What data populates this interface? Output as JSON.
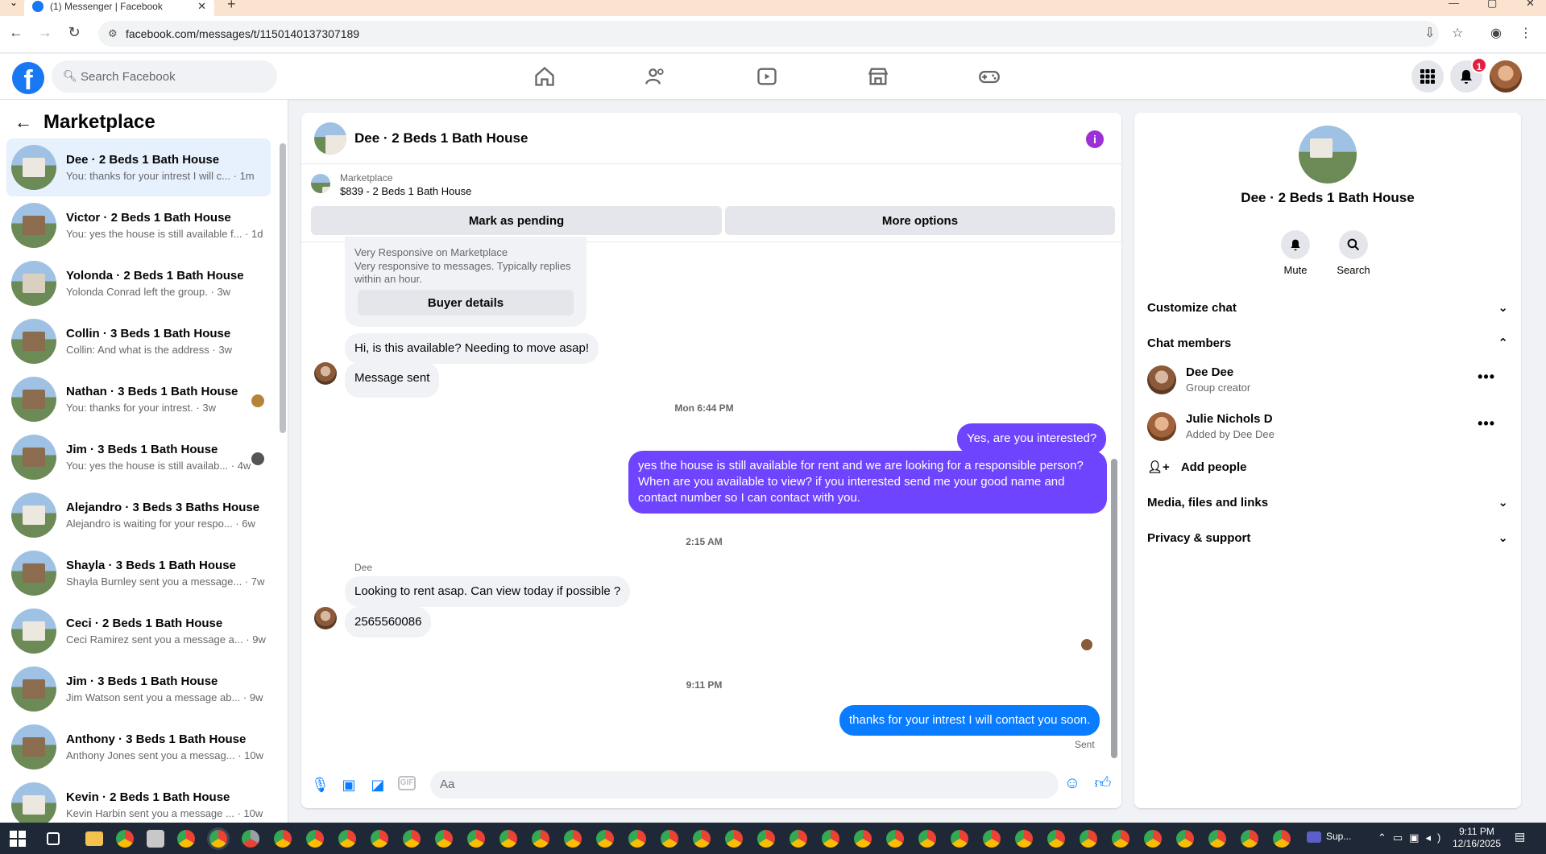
{
  "browser": {
    "tab_title": "(1) Messenger | Facebook",
    "url": "facebook.com/messages/t/1150140137307189"
  },
  "fb": {
    "search_placeholder": "Search Facebook",
    "notification_count": "1"
  },
  "left": {
    "title": "Marketplace",
    "conversations": [
      {
        "name": "Dee · 2 Beds 1 Bath House",
        "snippet": "You: thanks for your intrest I will c...",
        "time": "· 1m"
      },
      {
        "name": "Victor · 2 Beds 1 Bath House",
        "snippet": "You: yes the house is still available f...",
        "time": "· 1d"
      },
      {
        "name": "Yolonda · 2 Beds 1 Bath House",
        "snippet": "Yolonda Conrad left the group.",
        "time": "· 3w"
      },
      {
        "name": "Collin · 3 Beds 1 Bath House",
        "snippet": "Collin: And what is the address",
        "time": "· 3w"
      },
      {
        "name": "Nathan · 3 Beds 1 Bath House",
        "snippet": "You: thanks for your intrest.",
        "time": "· 3w"
      },
      {
        "name": "Jim · 3 Beds 1 Bath House",
        "snippet": "You: yes the house is still availab...",
        "time": "· 4w"
      },
      {
        "name": "Alejandro · 3 Beds 3 Baths House",
        "snippet": "Alejandro is waiting for your respo...",
        "time": "· 6w"
      },
      {
        "name": "Shayla · 3 Beds 1 Bath House",
        "snippet": "Shayla Burnley sent you a message...",
        "time": "· 7w"
      },
      {
        "name": "Ceci · 2 Beds 1 Bath House",
        "snippet": "Ceci Ramirez sent you a message a...",
        "time": "· 9w"
      },
      {
        "name": "Jim · 3 Beds 1 Bath House",
        "snippet": "Jim Watson sent you a message ab...",
        "time": "· 9w"
      },
      {
        "name": "Anthony · 3 Beds 1 Bath House",
        "snippet": "Anthony Jones sent you a messag...",
        "time": "· 10w"
      },
      {
        "name": "Kevin · 2 Beds 1 Bath House",
        "snippet": "Kevin Harbin sent you a message ...",
        "time": "· 10w"
      }
    ]
  },
  "chat": {
    "title": "Dee · 2 Beds 1 Bath House",
    "marketplace_label": "Marketplace",
    "listing": "$839 - 2 Beds 1 Bath House",
    "mark_pending": "Mark as pending",
    "more_options": "More options",
    "card_heading": "Very Responsive on Marketplace",
    "card_desc": "Very responsive to messages. Typically replies within an hour.",
    "buyer_details": "Buyer details",
    "msg1": "Hi, is this available? Needing to move asap!",
    "msg2": "Message sent",
    "ts1": "Mon 6:44 PM",
    "out1": "Yes, are you interested?",
    "out2": "yes the house is still available for rent and we are looking for a responsible person? When are you available to view? if you interested send me your good name and contact number  so I can contact with you.",
    "ts2": "2:15 AM",
    "sender": "Dee",
    "msg3": "Looking to rent asap. Can view today if possible ?",
    "msg4": "2565560086",
    "ts3": "9:11 PM",
    "out3": "thanks for your intrest I will contact you soon.",
    "sent": "Sent",
    "composer_placeholder": "Aa"
  },
  "right": {
    "name": "Dee · 2 Beds 1 Bath House",
    "mute": "Mute",
    "search": "Search",
    "customize": "Customize chat",
    "members_title": "Chat members",
    "members": [
      {
        "name": "Dee Dee",
        "sub": "Group creator"
      },
      {
        "name": "Julie Nichols D",
        "sub": "Added by Dee Dee"
      }
    ],
    "add_people": "Add people",
    "media": "Media, files and links",
    "privacy": "Privacy & support"
  },
  "taskbar": {
    "time": "9:11 PM",
    "date": "12/16/2025",
    "app_label": "Sup..."
  },
  "colors": {
    "brand": "#1877f2",
    "outgoing_purple": "#6e44ff",
    "outgoing_blue": "#0a7cff"
  }
}
